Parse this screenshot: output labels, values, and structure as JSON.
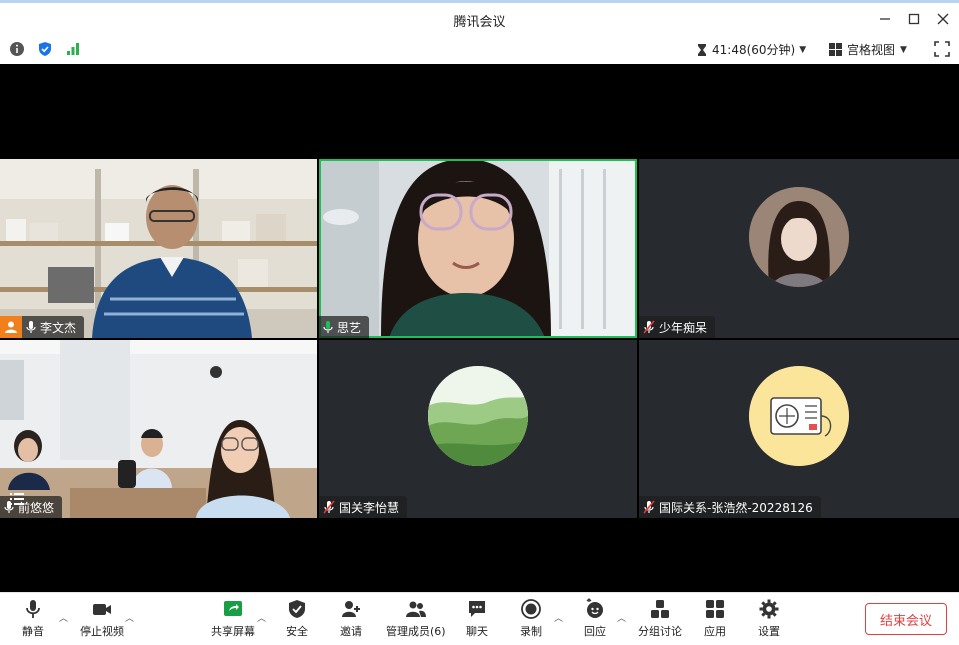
{
  "window": {
    "title": "腾讯会议"
  },
  "infobar": {
    "timer": "41:48(60分钟)",
    "view_label": "宫格视图"
  },
  "participants": [
    {
      "name": "李文杰"
    },
    {
      "name": "思艺"
    },
    {
      "name": "少年痴呆"
    },
    {
      "name": "前悠悠"
    },
    {
      "name": "国关李怡慧"
    },
    {
      "name": "国际关系-张浩然-20228126"
    }
  ],
  "toolbar": {
    "mute": "静音",
    "stop_video": "停止视频",
    "share": "共享屏幕",
    "security": "安全",
    "invite": "邀请",
    "members": "管理成员(6)",
    "chat": "聊天",
    "record": "录制",
    "react": "回应",
    "breakout": "分组讨论",
    "apps": "应用",
    "settings": "设置",
    "end": "结束会议"
  },
  "colors": {
    "active_border": "#1fbf58",
    "end_button": "#e04040",
    "accent_blue": "#1a73e8"
  }
}
